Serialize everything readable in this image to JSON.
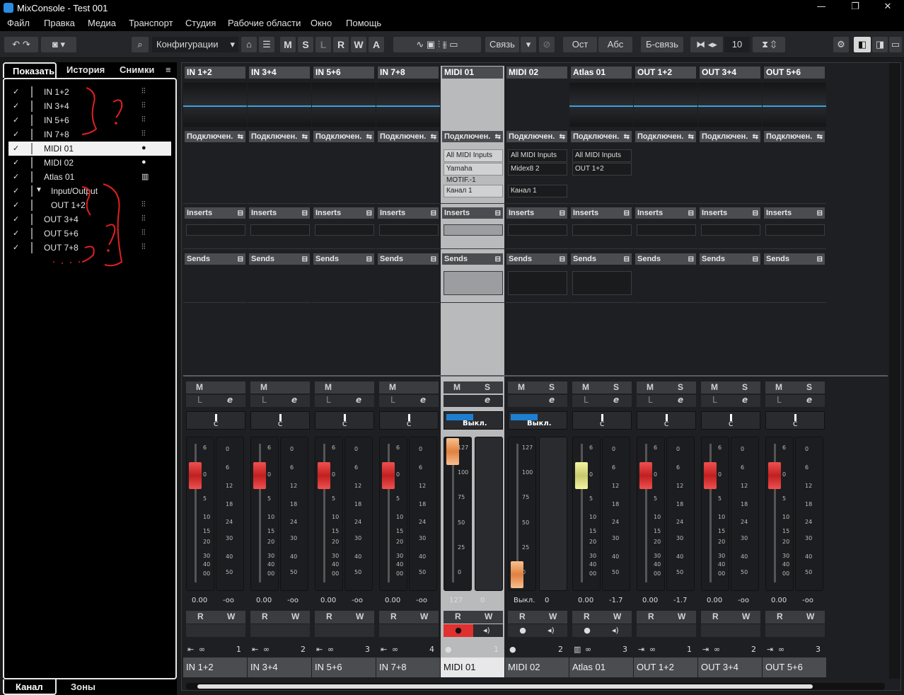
{
  "window": {
    "title": "MixConsole - Test 001",
    "minimize": "—",
    "restore": "❐",
    "close": "✕"
  },
  "menu": [
    "Файл",
    "Правка",
    "Медиа",
    "Транспорт",
    "Студия",
    "Рабочие области",
    "Окно",
    "Помощь"
  ],
  "toolbar": {
    "config_label": "Конфигурации",
    "mslrwa": [
      "M",
      "S",
      "L",
      "R",
      "W",
      "A"
    ],
    "link_label": "Связь",
    "ost": "Ост",
    "abs": "Абс",
    "blink": "Б-связь",
    "num": "10"
  },
  "left": {
    "tabs": [
      "Показать",
      "История",
      "Снимки"
    ],
    "menu_icon": "≡",
    "rows": [
      {
        "name": "IN 1+2",
        "icon": "waveform-icon"
      },
      {
        "name": "IN 3+4",
        "icon": "waveform-icon"
      },
      {
        "name": "IN 5+6",
        "icon": "waveform-icon"
      },
      {
        "name": "IN 7+8",
        "icon": "waveform-icon"
      },
      {
        "name": "MIDI 01",
        "icon": "midi-icon",
        "selected": true
      },
      {
        "name": "MIDI 02",
        "icon": "midi-icon"
      },
      {
        "name": "Atlas 01",
        "icon": "keyboard-icon"
      },
      {
        "name": "Input/Output",
        "icon": "",
        "folder": true
      },
      {
        "name": "OUT 1+2",
        "icon": "waveform-icon",
        "indent": true
      },
      {
        "name": "OUT 3+4",
        "icon": "waveform-icon"
      },
      {
        "name": "OUT 5+6",
        "icon": "waveform-icon"
      },
      {
        "name": "OUT 7+8",
        "icon": "waveform-icon"
      }
    ],
    "check": "✓",
    "bottom_tabs": [
      "Канал",
      "Зоны"
    ]
  },
  "labels": {
    "routing": "Подключен.",
    "inserts": "Inserts",
    "sends": "Sends"
  },
  "channels": [
    {
      "name": "IN 1+2",
      "type": "audio",
      "index": "1",
      "vol": "0.00",
      "peak": "-oo",
      "ms": [
        "M",
        ""
      ],
      "mode": "audio"
    },
    {
      "name": "IN 3+4",
      "type": "audio",
      "index": "2",
      "vol": "0.00",
      "peak": "-oo",
      "ms": [
        "M",
        ""
      ],
      "mode": "audio"
    },
    {
      "name": "IN 5+6",
      "type": "audio",
      "index": "3",
      "vol": "0.00",
      "peak": "-oo",
      "ms": [
        "M",
        ""
      ],
      "mode": "audio"
    },
    {
      "name": "IN 7+8",
      "type": "audio",
      "index": "4",
      "vol": "0.00",
      "peak": "-oo",
      "ms": [
        "M",
        ""
      ],
      "mode": "audio"
    },
    {
      "name": "MIDI 01",
      "type": "midi",
      "index": "1",
      "vol": "127",
      "peak": "0",
      "ms": [
        "M",
        "S"
      ],
      "io": [
        "All MIDI Inputs",
        "Yamaha MOTIF.-1"
      ],
      "channel": "Канал 1",
      "pan": "Выкл.",
      "mode": "midi",
      "selected": true
    },
    {
      "name": "MIDI 02",
      "type": "midi",
      "index": "2",
      "vol": "Выкл.",
      "peak": "0",
      "ms": [
        "M",
        "S"
      ],
      "io": [
        "All MIDI Inputs",
        "Midex8 2"
      ],
      "channel": "Канал 1",
      "pan": "Выкл.",
      "mode": "midi"
    },
    {
      "name": "Atlas 01",
      "type": "instrument",
      "index": "3",
      "vol": "0.00",
      "peak": "-1.7",
      "ms": [
        "M",
        "S"
      ],
      "io": [
        "All MIDI Inputs",
        "OUT 1+2"
      ],
      "mode": "inst"
    },
    {
      "name": "OUT 1+2",
      "type": "output",
      "index": "1",
      "vol": "0.00",
      "peak": "-1.7",
      "ms": [
        "M",
        "S"
      ],
      "mode": "out"
    },
    {
      "name": "OUT 3+4",
      "type": "output",
      "index": "2",
      "vol": "0.00",
      "peak": "-oo",
      "ms": [
        "M",
        "S"
      ],
      "mode": "out"
    },
    {
      "name": "OUT 5+6",
      "type": "output",
      "index": "3",
      "vol": "0.00",
      "peak": "-oo",
      "ms": [
        "M",
        "S"
      ],
      "mode": "out"
    }
  ],
  "scales": {
    "db_left": [
      "6",
      "0",
      "5",
      "10",
      "15",
      "20",
      "30",
      "40",
      "00"
    ],
    "db_right": [
      "0",
      "6",
      "12",
      "18",
      "24",
      "30",
      "40",
      "50"
    ],
    "midi": [
      "127",
      "100",
      "75",
      "50",
      "25",
      "0"
    ]
  },
  "pan_center": "C",
  "rw": [
    "R",
    "W"
  ],
  "colors": {
    "accent": "#3aa0e0",
    "fader_red": "#e03030",
    "fader_yellow": "#e8e890",
    "fader_orange": "#f0a060",
    "record": "#e03030"
  }
}
